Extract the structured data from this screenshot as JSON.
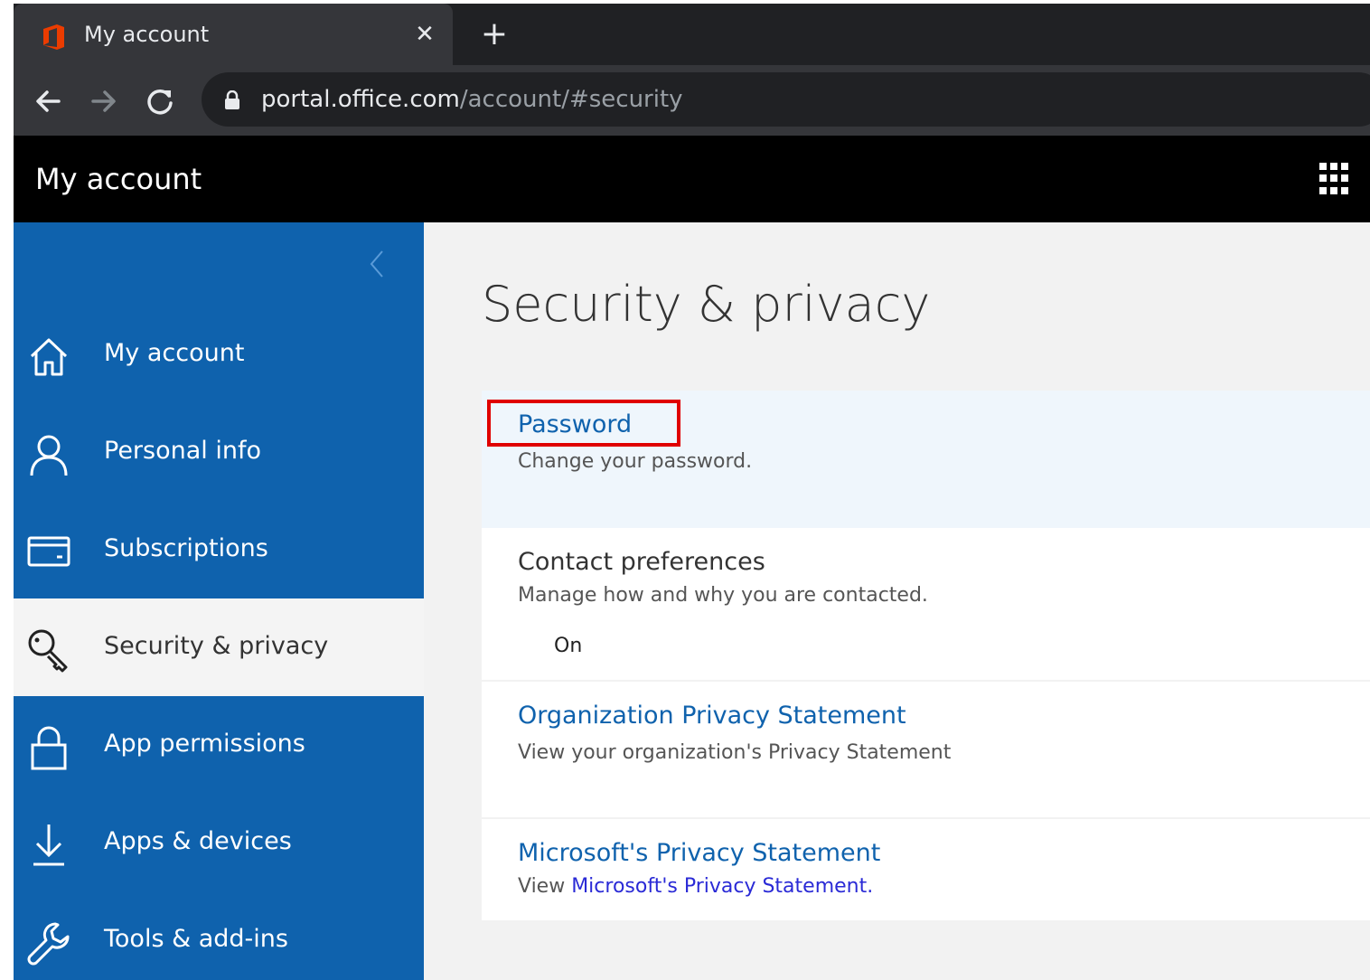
{
  "browser": {
    "tab_title": "My account",
    "tab_close": "✕",
    "new_tab": "+",
    "url_host": "portal.office.com",
    "url_path": "/account/#security"
  },
  "header": {
    "title": "My account"
  },
  "sidebar": {
    "items": [
      {
        "label": "My account",
        "icon": "home-icon"
      },
      {
        "label": "Personal info",
        "icon": "person-icon"
      },
      {
        "label": "Subscriptions",
        "icon": "credit-card-icon"
      },
      {
        "label": "Security & privacy",
        "icon": "key-search-icon",
        "active": true
      },
      {
        "label": "App permissions",
        "icon": "lock-icon"
      },
      {
        "label": "Apps & devices",
        "icon": "download-icon"
      },
      {
        "label": "Tools & add-ins",
        "icon": "wrench-icon"
      }
    ]
  },
  "main": {
    "title": "Security & privacy",
    "cards": [
      {
        "title": "Password",
        "description": "Change your password."
      },
      {
        "title": "Contact preferences",
        "description": "Manage how and why you are contacted.",
        "status": "On"
      },
      {
        "title": "Organization Privacy Statement",
        "description": "View your organization's Privacy Statement"
      },
      {
        "title": "Microsoft's Privacy Statement",
        "description_prefix": "View ",
        "description_link": "Microsoft's Privacy Statement."
      }
    ]
  },
  "colors": {
    "sidebar_bg": "#0f62ad",
    "link": "#0f62ad",
    "highlight_card": "#eff6fc",
    "annotation_box": "#e00000"
  }
}
